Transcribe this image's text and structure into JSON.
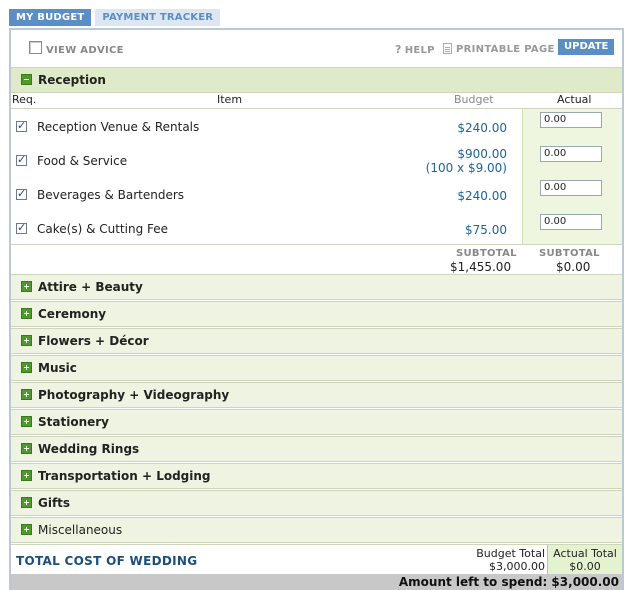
{
  "tabs": [
    {
      "label": "MY BUDGET",
      "active": true
    },
    {
      "label": "PAYMENT TRACKER",
      "active": false
    }
  ],
  "toolbar": {
    "view_advice_label": "VIEW ADVICE",
    "help_label": "HELP",
    "printable_label": "PRINTABLE PAGE",
    "update_label": "UPDATE"
  },
  "reception": {
    "title": "Reception",
    "columns": {
      "req": "Req.",
      "item": "Item",
      "budget": "Budget",
      "actual": "Actual"
    },
    "items": [
      {
        "label": "Reception Venue & Rentals",
        "budget": "$240.00",
        "budget_detail": "",
        "actual": "0.00",
        "checked": true
      },
      {
        "label": "Food & Service",
        "budget": "$900.00",
        "budget_detail": "(100 x $9.00)",
        "actual": "0.00",
        "checked": true
      },
      {
        "label": "Beverages & Bartenders",
        "budget": "$240.00",
        "budget_detail": "",
        "actual": "0.00",
        "checked": true
      },
      {
        "label": "Cake(s) & Cutting Fee",
        "budget": "$75.00",
        "budget_detail": "",
        "actual": "0.00",
        "checked": true
      }
    ],
    "subtotal_label": "SUBTOTAL",
    "subtotal_budget": "$1,455.00",
    "subtotal_actual": "$0.00"
  },
  "categories": [
    {
      "label": "Attire + Beauty"
    },
    {
      "label": "Ceremony"
    },
    {
      "label": "Flowers + Décor"
    },
    {
      "label": "Music"
    },
    {
      "label": "Photography + Videography"
    },
    {
      "label": "Stationery"
    },
    {
      "label": "Wedding Rings"
    },
    {
      "label": "Transportation + Lodging"
    },
    {
      "label": "Gifts"
    },
    {
      "label": "Miscellaneous"
    }
  ],
  "totals": {
    "label": "TOTAL COST OF WEDDING",
    "budget_total_label": "Budget Total",
    "budget_total": "$3,000.00",
    "actual_total_label": "Actual Total",
    "actual_total": "$0.00",
    "left_to_spend": "Amount left to spend: $3,000.00"
  },
  "colors": {
    "accent": "#5b8ec4",
    "section_bg": "#eef3e2",
    "icon_green": "#4c9a2a",
    "budget_text": "#1b6597"
  }
}
